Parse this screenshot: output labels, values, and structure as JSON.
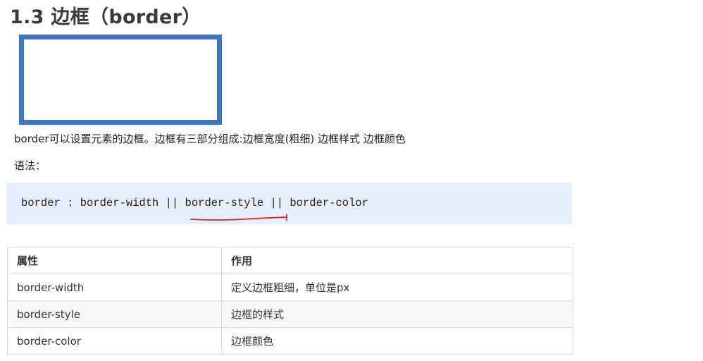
{
  "heading": "1.3 边框（border）",
  "intro": "border可以设置元素的边框。边框有三部分组成:边框宽度(粗细) 边框样式 边框颜色",
  "syntax_label": "语法：",
  "code": "border : border-width || border-style || border-color",
  "colors": {
    "demo_border": "#3f76c3",
    "code_background": "#e5eefb",
    "annotation": "#e02020"
  },
  "table": {
    "headers": [
      "属性",
      "作用"
    ],
    "rows": [
      [
        "border-width",
        "定义边框粗细，单位是px"
      ],
      [
        "border-style",
        "边框的样式"
      ],
      [
        "border-color",
        "边框颜色"
      ]
    ]
  }
}
